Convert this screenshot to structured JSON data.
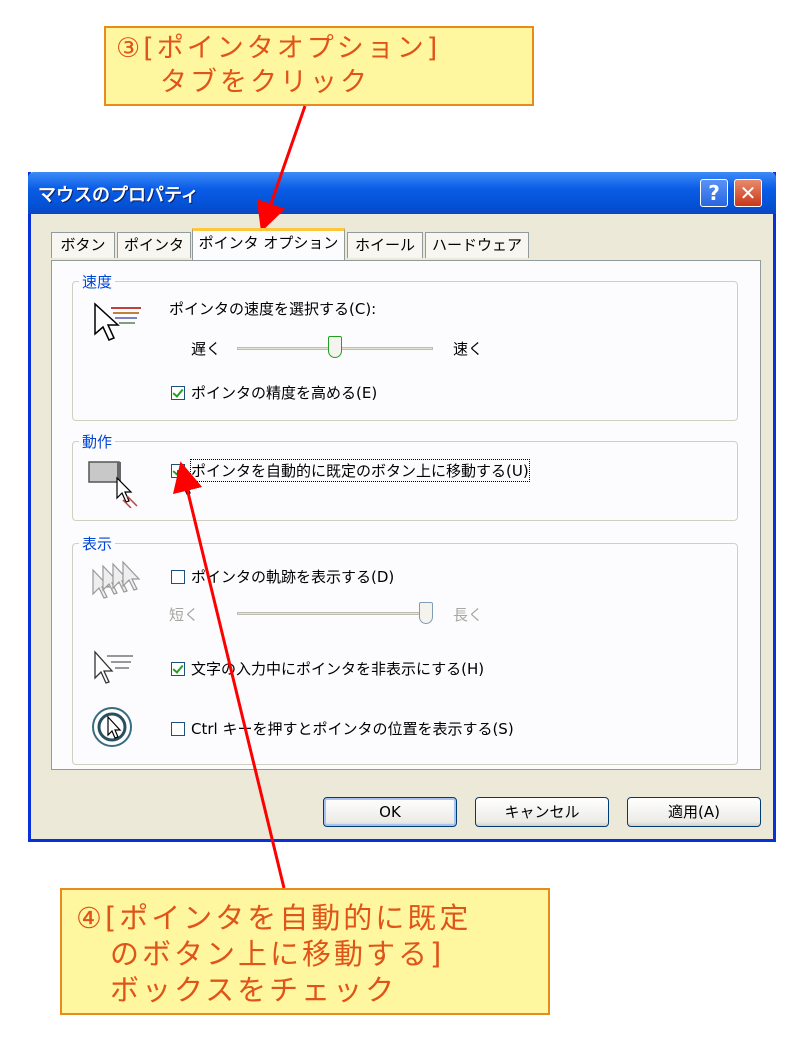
{
  "callouts": {
    "top_line1": "③[ポインタオプション]",
    "top_line2": "タブをクリック",
    "bottom_line1": "④[ポインタを自動的に既定",
    "bottom_line2": "のボタン上に移動する]",
    "bottom_line3": "ボックスをチェック"
  },
  "dialog": {
    "title": "マウスのプロパティ",
    "help_label": "?",
    "close_label": "✕"
  },
  "tabs": [
    {
      "label": "ボタン"
    },
    {
      "label": "ポインタ"
    },
    {
      "label": "ポインタ オプション",
      "active": true
    },
    {
      "label": "ホイール"
    },
    {
      "label": "ハードウェア"
    }
  ],
  "groups": {
    "speed": {
      "label": "速度",
      "prompt": "ポインタの速度を選択する(C):",
      "slow": "遅く",
      "fast": "速く",
      "speed_level": 0.5,
      "precision_label": "ポインタの精度を高める(E)",
      "precision_checked": true
    },
    "motion": {
      "label": "動作",
      "snap_label": "ポインタを自動的に既定のボタン上に移動する(U)",
      "snap_checked": true
    },
    "visibility": {
      "label": "表示",
      "trails_label": "ポインタの軌跡を表示する(D)",
      "trails_checked": false,
      "short": "短く",
      "long": "長く",
      "trail_level": 1.0,
      "hide_label": "文字の入力中にポインタを非表示にする(H)",
      "hide_checked": true,
      "ctrl_label": "Ctrl キーを押すとポインタの位置を表示する(S)",
      "ctrl_checked": false
    }
  },
  "buttons": {
    "ok": "OK",
    "cancel": "キャンセル",
    "apply": "適用(A)"
  },
  "colors": {
    "callout_bg": "#fff7a0",
    "callout_border": "#e98a1c",
    "callout_text": "#e0541a",
    "arrow": "#ff0000",
    "titlebar": "#0a5ce6",
    "group_label": "#0046d5"
  }
}
